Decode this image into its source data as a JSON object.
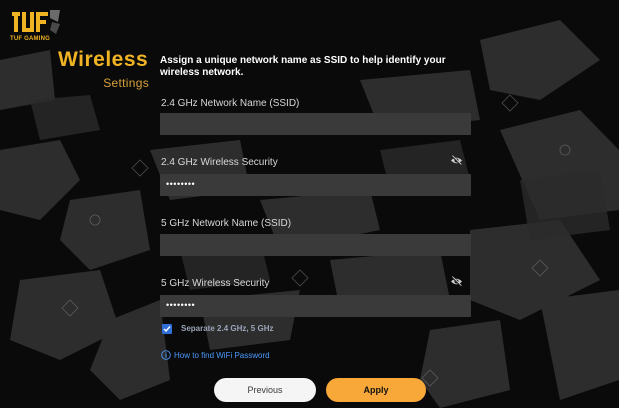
{
  "brand": {
    "logo_text": "TUF GAMING",
    "accent": "#f0b323"
  },
  "page": {
    "title": "Wireless",
    "subtitle": "Settings"
  },
  "description": "Assign a unique network name as SSID to help identify your wireless network.",
  "fields": {
    "ssid_24": {
      "label": "2.4 GHz Network Name (SSID)",
      "value": ""
    },
    "security_24": {
      "label": "2.4 GHz Wireless Security",
      "value": "••••••••",
      "icon": "eye-slash-icon"
    },
    "ssid_5": {
      "label": "5 GHz Network Name (SSID)",
      "value": ""
    },
    "security_5": {
      "label": "5 GHz Wireless Security",
      "value": "••••••••",
      "icon": "eye-slash-icon"
    }
  },
  "separate": {
    "label": "Separate 2.4 GHz, 5 GHz",
    "checked": true
  },
  "help": {
    "link": "How to find WiFi Password",
    "icon": "info-icon"
  },
  "buttons": {
    "previous": "Previous",
    "apply": "Apply"
  }
}
